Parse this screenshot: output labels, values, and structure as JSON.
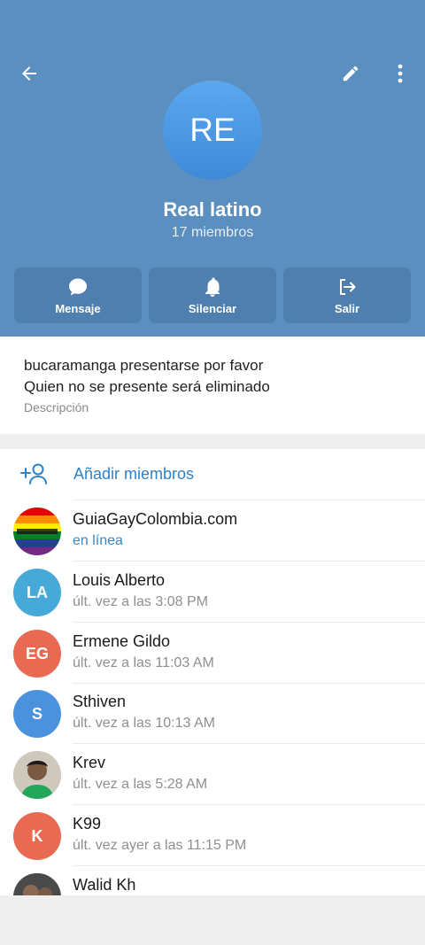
{
  "header": {
    "avatar_initials": "RE",
    "title": "Real latino",
    "subtitle": "17 miembros",
    "actions": [
      {
        "label": "Mensaje",
        "icon": "chat-bubble-icon"
      },
      {
        "label": "Silenciar",
        "icon": "bell-icon"
      },
      {
        "label": "Salir",
        "icon": "logout-icon"
      }
    ],
    "colors": {
      "background": "#5b8fbf",
      "button": "#4f7fae"
    }
  },
  "description": {
    "line1": "bucaramanga presentarse por favor",
    "line2": "Quien no se presente será eliminado",
    "label": "Descripción"
  },
  "members": {
    "add_label": "Añadir miembros",
    "list": [
      {
        "name": "GuiaGayColombia.com",
        "status": "en línea",
        "avatar": "rainbow-flag-image",
        "online": true
      },
      {
        "name": "Louis Alberto",
        "status": "últ. vez a las 3:08 PM",
        "initials": "LA",
        "color": "#46a9d8"
      },
      {
        "name": "Ermene Gildo",
        "status": "últ. vez a las 11:03 AM",
        "initials": "EG",
        "color": "#e86a52"
      },
      {
        "name": "Sthiven",
        "status": "últ. vez a las 10:13 AM",
        "initials": "S",
        "color": "#4a92de"
      },
      {
        "name": "Krev",
        "status": "últ. vez a las 5:28 AM",
        "avatar": "profile-photo"
      },
      {
        "name": "K99",
        "status": "últ. vez ayer a las 11:15 PM",
        "initials": "K",
        "color": "#e86a52"
      },
      {
        "name": "Walid Kh",
        "status": "",
        "avatar": "profile-photo"
      }
    ]
  }
}
